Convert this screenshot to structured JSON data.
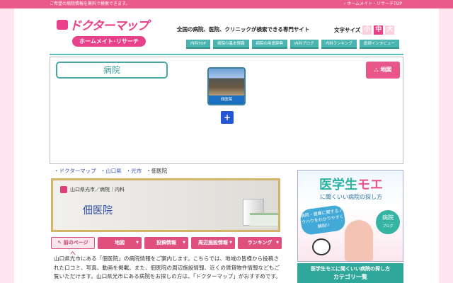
{
  "topbar": {
    "notice": "ご希望の病院情報を無料で検索できます。",
    "home_link": "› ホームメイト・リサーチTOP"
  },
  "header": {
    "logo_main": "ドクターマップ",
    "logo_sub": "ホームメイト･リサーチ",
    "tagline": "全国の病院、医院、クリニックが検索できる専門サイト",
    "font_size": {
      "label": "文字サイズ",
      "small": "小",
      "medium": "中",
      "large": "大"
    },
    "nav": [
      "内科TOP",
      "病院の基本情報",
      "病院の用語辞典",
      "内科ブログ",
      "内科ランキング",
      "医師インタビュー"
    ]
  },
  "map": {
    "category_label": "病院",
    "map_button": "地図",
    "pin_label": "佃医院",
    "colors": {
      "accent": "#e9578a",
      "teal": "#4ab5b0"
    }
  },
  "breadcrumb": [
    "ドクターマップ",
    "山口県",
    "光市",
    "佃医院"
  ],
  "banner": {
    "category": "山口県光市／病院｜内科",
    "title": "佃医院"
  },
  "tabs": {
    "back": "前のページへ",
    "items": [
      "地図",
      "投稿情報",
      "周辺施設情報",
      "ランキング"
    ]
  },
  "description": "山口県光市にある「佃医院」の病院情報をご案内します。こちらでは、地域の皆様から投稿された口コミ、写真、動画を掲載。また、佃医院の周辺施設情報、近くの賃貸物件情報などもご覧いただけます。山口県光市にある病院をお探しの方は、「ドクターマップ」がおすすめです。",
  "ad": {
    "title_a": "医学生",
    "title_b": "モエ",
    "subtitle": "に聞くいい病院の探し方",
    "bubble": "病院・健康に関するノウハウをわかりやすく解説!!",
    "badge": "病院",
    "badge_sub": "ブログ",
    "caption_1": "医学生モエに聞くいい病院の探し方",
    "caption_2": "カテゴリ一覧"
  }
}
